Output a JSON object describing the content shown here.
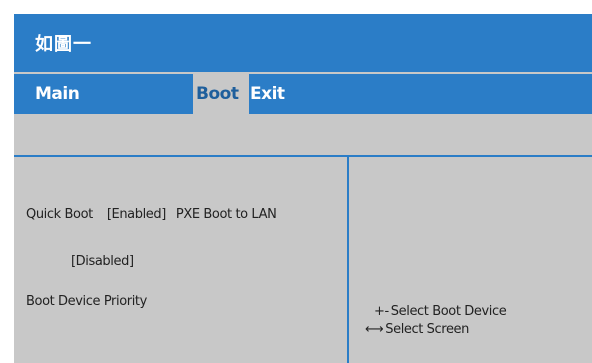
{
  "window": {
    "title": "如圖一"
  },
  "menu": {
    "main_label": "Main",
    "boot_label": "Boot",
    "exit_label": "Exit"
  },
  "settings": {
    "quick_boot_label": "Quick Boot",
    "quick_boot_value": "[Enabled]",
    "pxe_label": "PXE Boot to LAN",
    "pxe_value": "[Disabled]",
    "priority_label": "Boot Device Priority"
  },
  "help": {
    "select_device_keys": "+-",
    "select_device_text": "Select Boot Device",
    "select_screen_keys": "⟷",
    "select_screen_text": "Select Screen"
  },
  "colors": {
    "accent": "#2b7dc7",
    "panel": "#c8c8c8",
    "text": "#222222"
  }
}
